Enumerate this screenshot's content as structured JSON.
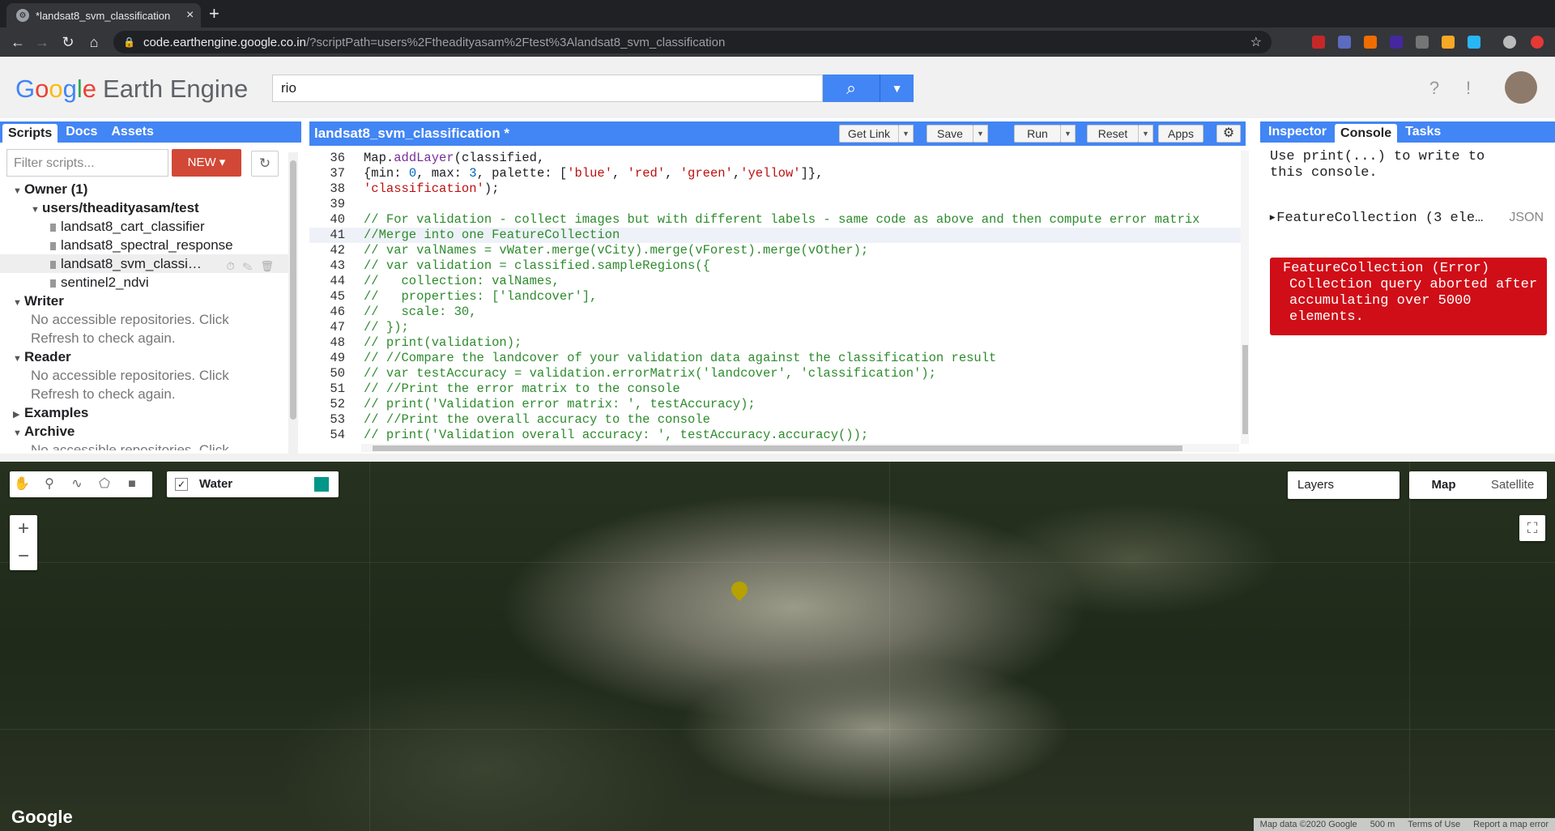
{
  "browser": {
    "tab_title": "*landsat8_svm_classification",
    "url_host": "code.earthengine.google.co.in",
    "url_path": "/?scriptPath=users%2Ftheadityasam%2Ftest%3Alandsat8_svm_classification"
  },
  "header": {
    "logo_google": [
      "G",
      "o",
      "o",
      "g",
      "l",
      "e"
    ],
    "logo_product": "Earth Engine",
    "search_value": "rio"
  },
  "left_panel": {
    "tabs": [
      "Scripts",
      "Docs",
      "Assets"
    ],
    "filter_placeholder": "Filter scripts...",
    "new_label": "NEW",
    "tree": {
      "owner": "Owner",
      "owner_count": "(1)",
      "repo": "users/theadityasam/test",
      "files": [
        "landsat8_cart_classifier",
        "landsat8_spectral_response",
        "landsat8_svm_classi…",
        "sentinel2_ndvi"
      ],
      "writer": "Writer",
      "writer_msg1": "No accessible repositories. Click",
      "writer_msg2": "Refresh to check again.",
      "reader": "Reader",
      "reader_msg1": "No accessible repositories. Click",
      "reader_msg2": "Refresh to check again.",
      "examples": "Examples",
      "archive": "Archive",
      "archive_msg1": "No accessible repositories. Click"
    }
  },
  "editor": {
    "title": "landsat8_svm_classification *",
    "buttons": {
      "get_link": "Get Link",
      "save": "Save",
      "run": "Run",
      "reset": "Reset",
      "apps": "Apps"
    },
    "lines": [
      {
        "n": "36",
        "t": "Map.addLayer(classified,"
      },
      {
        "n": "37",
        "t": "{min: 0, max: 3, palette: ['blue', 'red', 'green','yellow']},"
      },
      {
        "n": "38",
        "t": "'classification');"
      },
      {
        "n": "39",
        "t": ""
      },
      {
        "n": "40",
        "t": "// For validation - collect images but with different labels - same code as above and then compute error matrix"
      },
      {
        "n": "41",
        "t": "//Merge into one FeatureCollection"
      },
      {
        "n": "42",
        "t": "// var valNames = vWater.merge(vCity).merge(vForest).merge(vOther);"
      },
      {
        "n": "43",
        "t": "// var validation = classified.sampleRegions({"
      },
      {
        "n": "44",
        "t": "//   collection: valNames,"
      },
      {
        "n": "45",
        "t": "//   properties: ['landcover'],"
      },
      {
        "n": "46",
        "t": "//   scale: 30,"
      },
      {
        "n": "47",
        "t": "// });"
      },
      {
        "n": "48",
        "t": "// print(validation);"
      },
      {
        "n": "49",
        "t": "// //Compare the landcover of your validation data against the classification result"
      },
      {
        "n": "50",
        "t": "// var testAccuracy = validation.errorMatrix('landcover', 'classification');"
      },
      {
        "n": "51",
        "t": "// //Print the error matrix to the console"
      },
      {
        "n": "52",
        "t": "// print('Validation error matrix: ', testAccuracy);"
      },
      {
        "n": "53",
        "t": "// //Print the overall accuracy to the console"
      },
      {
        "n": "54",
        "t": "// print('Validation overall accuracy: ', testAccuracy.accuracy());"
      }
    ]
  },
  "right_panel": {
    "tabs": [
      "Inspector",
      "Console",
      "Tasks"
    ],
    "hint": "Use print(...) to write to this console.",
    "feature_collection": "FeatureCollection (3 ele…",
    "json_label": "JSON",
    "error_title": "FeatureCollection (Error)",
    "error_msg": "Collection query aborted after accumulating over 5000 elements."
  },
  "map": {
    "legend_label": "Water",
    "legend_color": "#009688",
    "layers_label": "Layers",
    "maptype": [
      "Map",
      "Satellite"
    ],
    "zoom_in": "+",
    "zoom_out": "−",
    "watermark": "Google",
    "attribution": [
      "Map data ©2020 Google",
      "500 m",
      "Terms of Use",
      "Report a map error"
    ]
  }
}
